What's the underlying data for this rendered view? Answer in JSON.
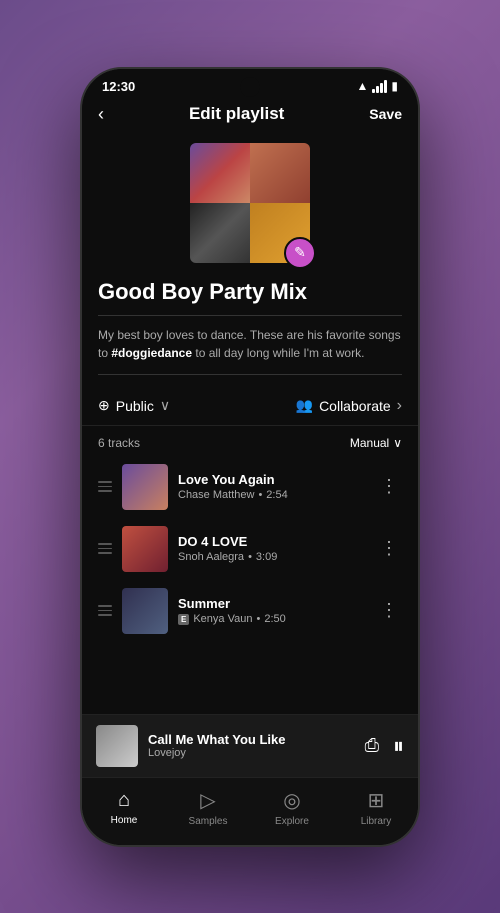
{
  "statusBar": {
    "time": "12:30",
    "wifiLabel": "wifi",
    "signalLabel": "signal",
    "batteryLabel": "battery"
  },
  "header": {
    "backLabel": "<",
    "title": "Edit playlist",
    "saveLabel": "Save"
  },
  "playlist": {
    "name": "Good Boy Party Mix",
    "description": "My best boy loves to dance. These are his favorite songs to ",
    "hashtag": "#doggiedance",
    "descriptionSuffix": " to all day long while I'm at work.",
    "visibility": "Public",
    "collaborateLabel": "Collaborate",
    "trackCount": "6 tracks",
    "sortLabel": "Manual"
  },
  "tracks": [
    {
      "name": "Love You Again",
      "artist": "Chase Matthew",
      "duration": "2:54",
      "explicit": false,
      "artStyle": "track-art-1"
    },
    {
      "name": "DO 4 LOVE",
      "artist": "Snoh Aalegra",
      "duration": "3:09",
      "explicit": false,
      "artStyle": "track-art-2"
    },
    {
      "name": "Summer",
      "artist": "Kenya Vaun",
      "duration": "2:50",
      "explicit": true,
      "artStyle": "track-art-3"
    }
  ],
  "nowPlaying": {
    "title": "Call Me What You Like",
    "artist": "Lovejoy",
    "artStyle": "np-art"
  },
  "bottomNav": [
    {
      "id": "home",
      "label": "Home",
      "icon": "⌂",
      "active": true
    },
    {
      "id": "samples",
      "label": "Samples",
      "icon": "▷",
      "active": false
    },
    {
      "id": "explore",
      "label": "Explore",
      "icon": "◎",
      "active": false
    },
    {
      "id": "library",
      "label": "Library",
      "icon": "⊞",
      "active": false
    }
  ],
  "icons": {
    "globe": "⊕",
    "people": "👥",
    "chevronDown": "∨",
    "chevronRight": "›",
    "moreVert": "⋮",
    "cast": "⎙",
    "pause": "⏸",
    "pencil": "✎"
  }
}
